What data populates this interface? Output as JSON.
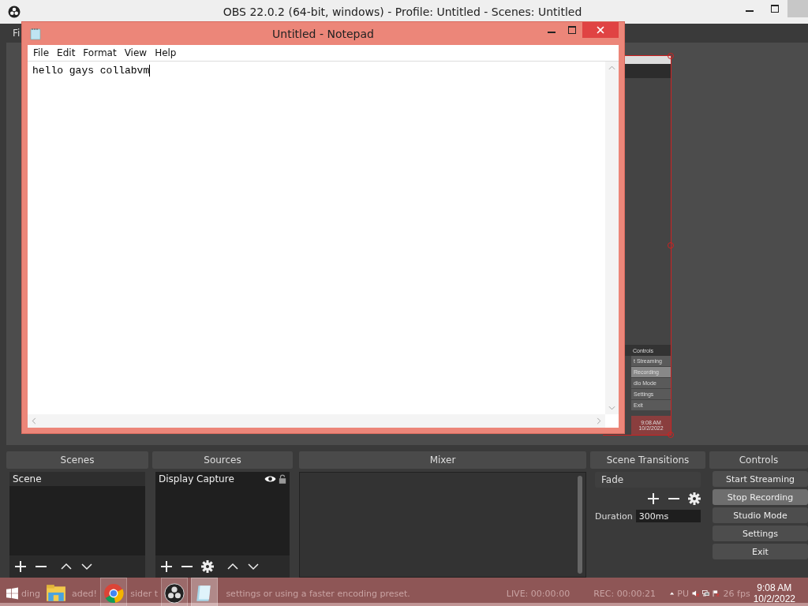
{
  "obs_window": {
    "title": "OBS 22.0.2 (64-bit, windows) - Profile: Untitled - Scenes: Untitled",
    "menu": [
      "Fi"
    ]
  },
  "notepad": {
    "title": "Untitled - Notepad",
    "menu": [
      "File",
      "Edit",
      "Format",
      "View",
      "Help"
    ],
    "text": "hello gays collabvm"
  },
  "preview_capture": {
    "header": "Controls",
    "buttons": [
      {
        "label": "t Streaming",
        "active": false
      },
      {
        "label": "Recording",
        "active": true
      },
      {
        "label": "dio Mode",
        "active": false
      },
      {
        "label": "Settings",
        "active": false
      },
      {
        "label": "Exit",
        "active": false
      }
    ],
    "time": "9:08 AM",
    "date": "10/2/2022"
  },
  "scenes": {
    "title": "Scenes",
    "items": [
      {
        "label": "Scene",
        "selected": true
      }
    ]
  },
  "sources": {
    "title": "Sources",
    "items": [
      {
        "label": "Display Capture",
        "selected": false,
        "visible": true,
        "locked": false
      }
    ]
  },
  "mixer": {
    "title": "Mixer"
  },
  "transitions": {
    "title": "Scene Transitions",
    "transition": "Fade",
    "duration_label": "Duration",
    "duration": "300ms"
  },
  "controls": {
    "title": "Controls",
    "buttons": [
      {
        "label": "Start Streaming",
        "active": false
      },
      {
        "label": "Stop Recording",
        "active": true
      },
      {
        "label": "Studio Mode",
        "active": false
      },
      {
        "label": "Settings",
        "active": false
      },
      {
        "label": "Exit",
        "active": false
      }
    ]
  },
  "status_bar": {
    "message_fragments": [
      "ding",
      "aded!",
      "sider t",
      "settings or using a faster encoding preset."
    ],
    "live": "LIVE: 00:00:00",
    "rec": "REC: 00:00:21",
    "cpu_fragments": [
      "PU",
      "26 fps"
    ]
  },
  "taskbar": {
    "apps": [
      {
        "kind": "explorer",
        "running": false,
        "selected": false
      },
      {
        "kind": "chrome",
        "running": true,
        "selected": false
      },
      {
        "kind": "obs",
        "running": true,
        "selected": false
      },
      {
        "kind": "notepad",
        "running": true,
        "selected": true
      }
    ],
    "time": "9:08 AM",
    "date": "10/2/2022"
  }
}
